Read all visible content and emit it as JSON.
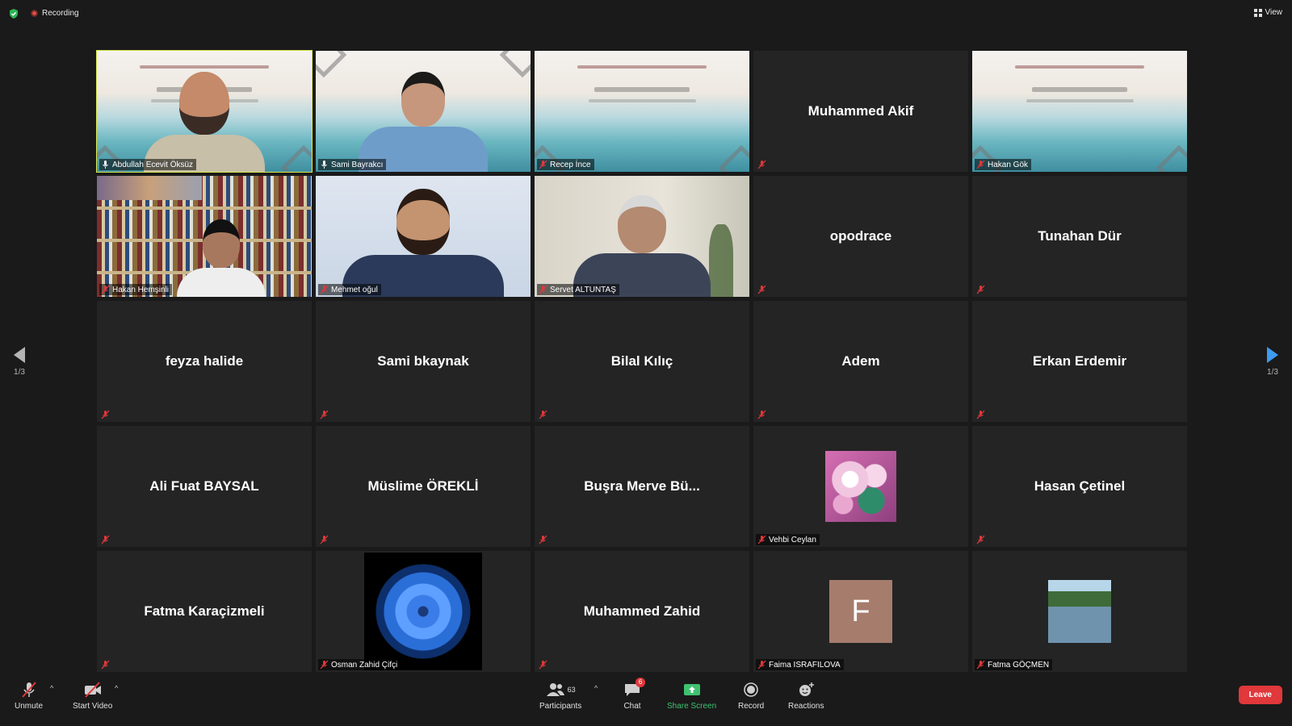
{
  "topbar": {
    "recording_label": "Recording",
    "view_label": "View"
  },
  "pagination": {
    "left": "1/3",
    "right": "1/3"
  },
  "tiles": [
    {
      "name": "Abdullah Ecevit Öksüz"
    },
    {
      "name": "Sami Bayrakcı"
    },
    {
      "name": "Recep İnce"
    },
    {
      "name": "Muhammed Akif"
    },
    {
      "name": "Hakan Gök"
    },
    {
      "name": "Hakan Hemşinli"
    },
    {
      "name": "Mehmet oğul"
    },
    {
      "name": "Servet ALTUNTAŞ"
    },
    {
      "name": "opodrace"
    },
    {
      "name": "Tunahan Dür"
    },
    {
      "name": "feyza halide"
    },
    {
      "name": "Sami bkaynak"
    },
    {
      "name": "Bilal Kılıç"
    },
    {
      "name": "Adem"
    },
    {
      "name": "Erkan Erdemir"
    },
    {
      "name": "Ali Fuat BAYSAL"
    },
    {
      "name": "Müslime ÖREKLİ"
    },
    {
      "name": "Buşra Merve Bü..."
    },
    {
      "name": "Vehbi Ceylan"
    },
    {
      "name": "Hasan Çetinel"
    },
    {
      "name": "Fatma Karaçizmeli"
    },
    {
      "name": "Osman Zahid Çifçi"
    },
    {
      "name": "Muhammed Zahid"
    },
    {
      "name": "Faima ISRAFILOVA",
      "avatar_letter": "F"
    },
    {
      "name": "Fatma GÖÇMEN"
    }
  ],
  "toolbar": {
    "unmute": "Unmute",
    "start_video": "Start Video",
    "participants": "Participants",
    "participants_count": "63",
    "chat": "Chat",
    "chat_badge": "6",
    "share_screen": "Share Screen",
    "record": "Record",
    "reactions": "Reactions",
    "leave": "Leave"
  },
  "colors": {
    "accent_green": "#3ec270",
    "leave_red": "#e0383b",
    "speaker_outline": "#d8e84a"
  }
}
